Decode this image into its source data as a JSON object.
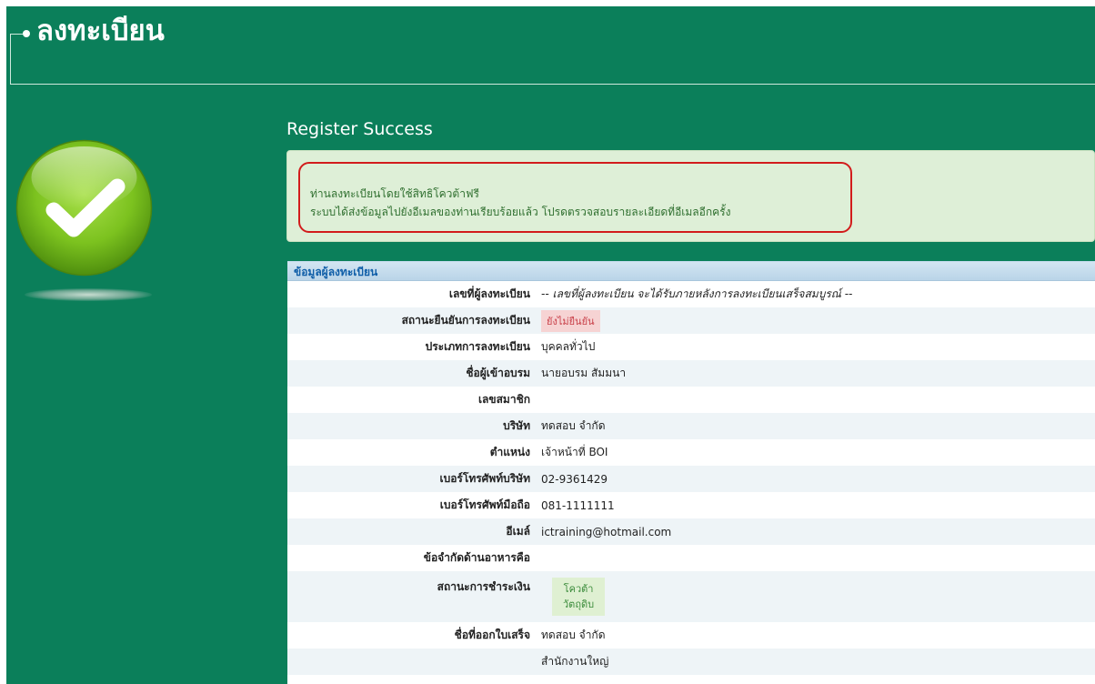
{
  "page": {
    "title": "ลงทะเบียน",
    "heading": "Register Success"
  },
  "colors": {
    "background": "#0b7f5a",
    "notice_bg": "#deefd7",
    "notice_border": "#d21c1c",
    "panel_header": "#0f5ea8",
    "success_icon": "#7cc21f"
  },
  "icons": {
    "status_icon": "check-circle-icon"
  },
  "notice": {
    "line1": "ท่านลงทะเบียนโดยใช้สิทธิโควต้าฟรี",
    "line2": "ระบบได้ส่งข้อมูลไปยังอีเมลของท่านเรียบร้อยแล้ว โปรดตรวจสอบรายละเอียดที่อีเมลอีกครั้ง"
  },
  "registrant": {
    "section_title": "ข้อมูลผู้ลงทะเบียน",
    "registration_no_label": "เลขที่ผู้ลงทะเบียน",
    "registration_no_value": "-- เลขที่ผู้ลงทะเบียน จะได้รับภายหลังการลงทะเบียนเสร็จสมบูรณ์ --",
    "confirm_status_label": "สถานะยืนยันการลงทะเบียน",
    "confirm_status_value": "ยังไม่ยืนยัน",
    "type_label": "ประเภทการลงทะเบียน",
    "type_value": "บุคคลทั่วไป",
    "name_label": "ชื่อผู้เข้าอบรม",
    "name_value": "นายอบรม สัมมนา",
    "member_no_label": "เลขสมาชิก",
    "member_no_value": "",
    "company_label": "บริษัท",
    "company_value": "ทดสอบ จำกัด",
    "position_label": "ตำแหน่ง",
    "position_value": "เจ้าหน้าที่ BOI",
    "company_phone_label": "เบอร์โทรศัพท์บริษัท",
    "company_phone_value": "02-9361429",
    "mobile_label": "เบอร์โทรศัพท์มือถือ",
    "mobile_value": "081-1111111",
    "email_label": "อีเมล์",
    "email_value": "ictraining@hotmail.com",
    "food_label": "ข้อจำกัดด้านอาหารคือ",
    "food_value": "",
    "payment_label": "สถานะการชำระเงิน",
    "payment_line1": "โควต้า",
    "payment_line2": "วัตถุดิบ",
    "invoice_name_label": "ชื่อที่ออกใบเสร็จ",
    "invoice_name_value": "ทดสอบ จำกัด",
    "branch_value": "สำนักงานใหญ่"
  }
}
